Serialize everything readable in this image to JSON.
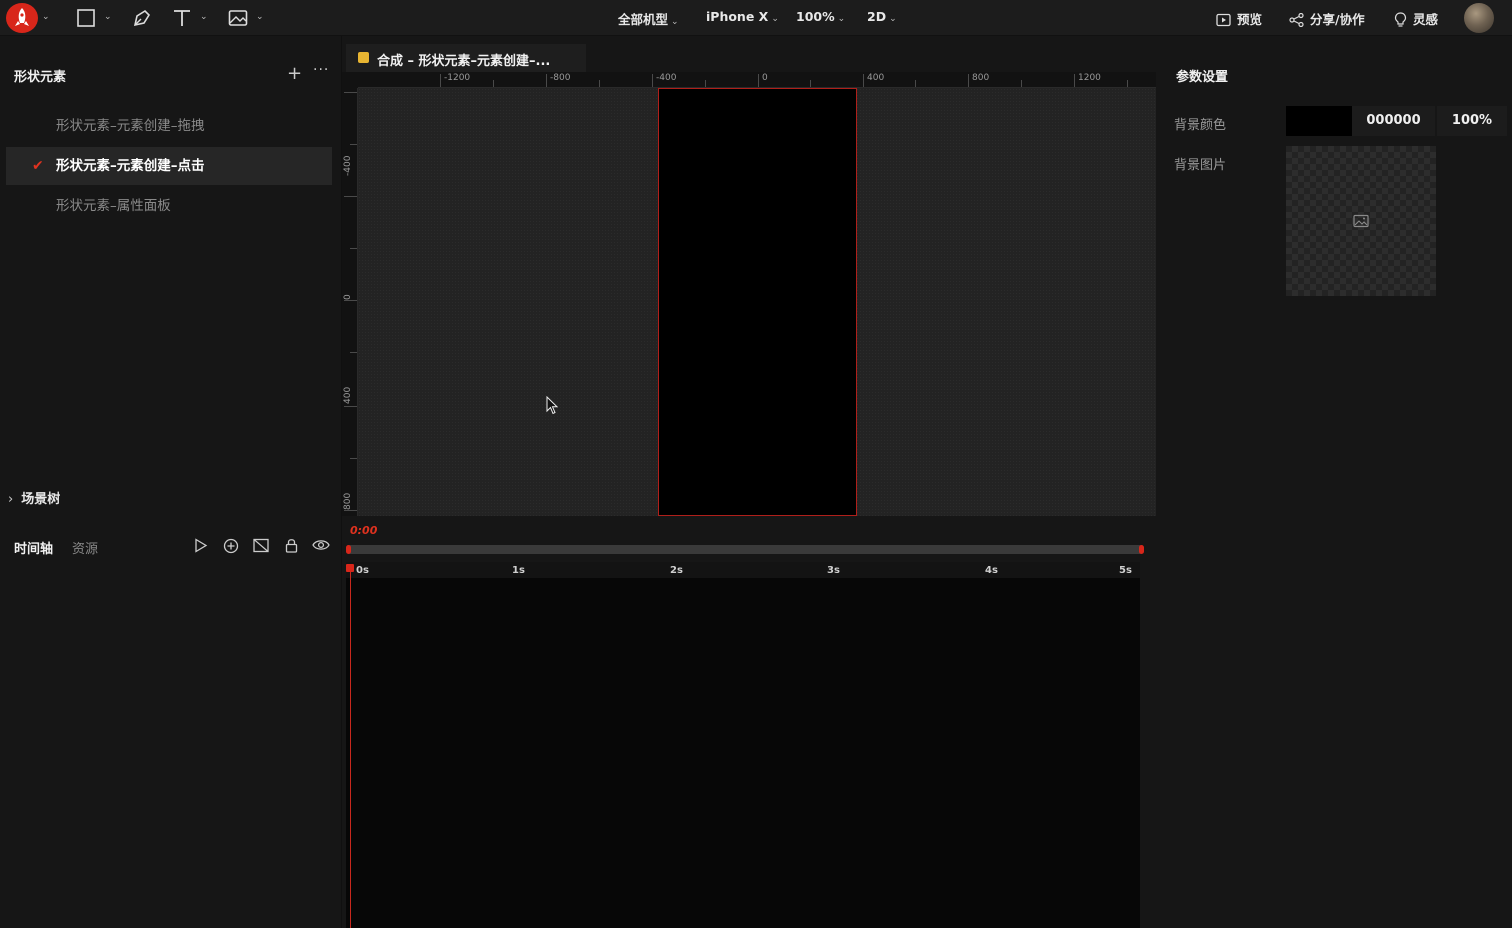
{
  "topbar": {
    "tools": [
      "rectangle-tool",
      "pen-tool",
      "text-tool",
      "image-tool"
    ],
    "device_menu": "全部机型",
    "model_menu": "iPhone X",
    "zoom_menu": "100%",
    "mode_menu": "2D",
    "preview": "预览",
    "share": "分享/协作",
    "inspiration": "灵感"
  },
  "left_panel": {
    "title": "形状元素",
    "pages": [
      {
        "label": "形状元素–元素创建–拖拽",
        "active": false
      },
      {
        "label": "形状元素–元素创建–点击",
        "active": true
      },
      {
        "label": "形状元素–属性面板",
        "active": false
      }
    ],
    "scene_tree": "场景树"
  },
  "canvas": {
    "tab_label": "合成 – 形状元素–元素创建–...",
    "ruler_top": [
      "-1200",
      "-800",
      "-400",
      "0",
      "400",
      "800",
      "1200"
    ],
    "ruler_left": [
      "-400",
      "0",
      "400",
      "800"
    ]
  },
  "right_panel": {
    "title": "参数设置",
    "bg_color_label": "背景颜色",
    "bg_color_hex": "000000",
    "bg_opacity": "100%",
    "bg_image_label": "背景图片"
  },
  "timeline": {
    "tab_timeline": "时间轴",
    "tab_assets": "资源",
    "current_time": "0:00",
    "ticks": [
      "0s",
      "1s",
      "2s",
      "3s",
      "4s",
      "5s"
    ]
  },
  "colors": {
    "accent": "#d8261a",
    "background": "#161616",
    "artboard": "#000000"
  }
}
